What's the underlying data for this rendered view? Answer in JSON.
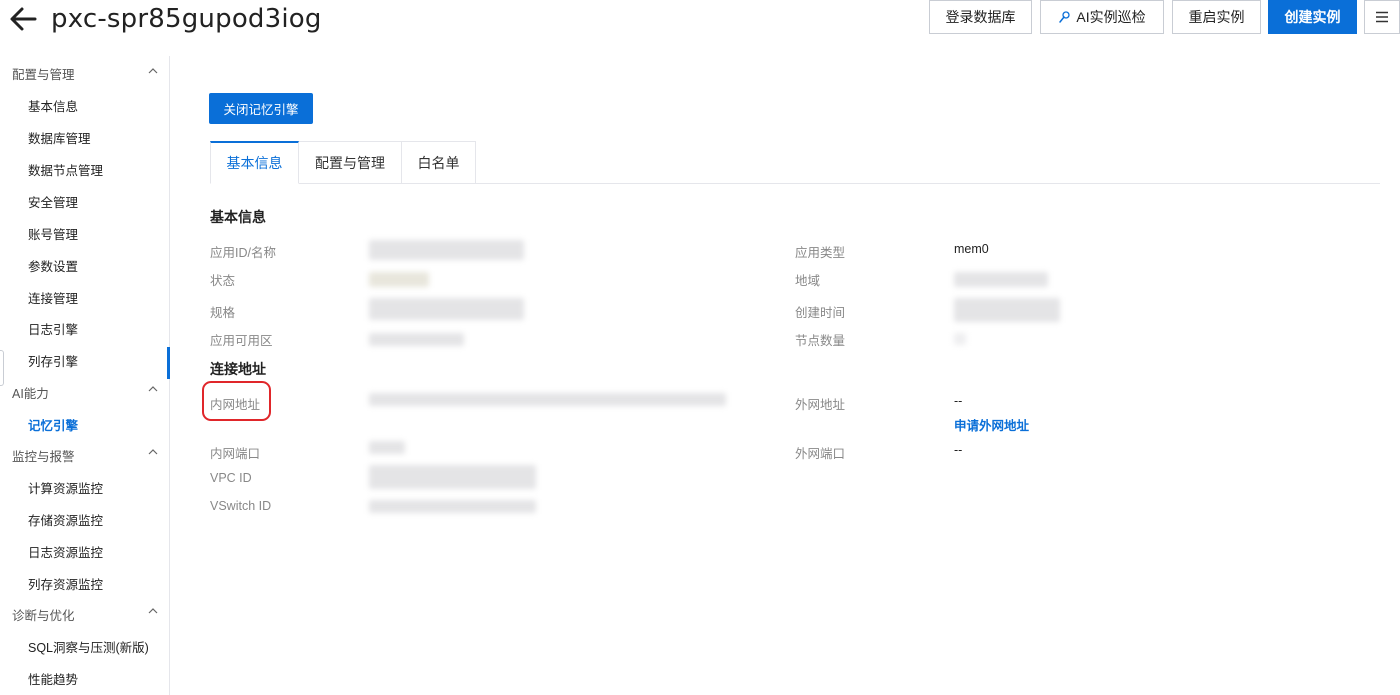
{
  "header": {
    "title": "pxc-spr85gupod3iog",
    "buttons": {
      "login_db": "登录数据库",
      "ai_inspect": "AI实例巡检",
      "restart": "重启实例",
      "create": "创建实例"
    }
  },
  "sidebar": {
    "groups": [
      {
        "label": "配置与管理",
        "items": [
          "基本信息",
          "数据库管理",
          "数据节点管理",
          "安全管理",
          "账号管理",
          "参数设置",
          "连接管理",
          "日志引擎",
          "列存引擎"
        ]
      },
      {
        "label": "AI能力",
        "items": [
          "记忆引擎"
        ]
      },
      {
        "label": "监控与报警",
        "items": [
          "计算资源监控",
          "存储资源监控",
          "日志资源监控",
          "列存资源监控"
        ]
      },
      {
        "label": "诊断与优化",
        "items": [
          "SQL洞察与压测(新版)",
          "性能趋势"
        ]
      }
    ],
    "active_item": "记忆引擎"
  },
  "main": {
    "close_button": "关闭记忆引擎",
    "tabs": [
      "基本信息",
      "配置与管理",
      "白名单"
    ],
    "active_tab": "基本信息",
    "basic_info": {
      "title": "基本信息",
      "app_id_label": "应用ID/名称",
      "status_label": "状态",
      "spec_label": "规格",
      "zone_label": "应用可用区",
      "app_type_label": "应用类型",
      "app_type_value": "mem0",
      "region_label": "地域",
      "created_label": "创建时间",
      "nodes_label": "节点数量"
    },
    "connection": {
      "title": "连接地址",
      "intranet_addr_label": "内网地址",
      "internet_addr_label": "外网地址",
      "internet_addr_value": "--",
      "apply_internet_link": "申请外网地址",
      "intranet_port_label": "内网端口",
      "internet_port_label": "外网端口",
      "internet_port_value": "--",
      "vpc_label": "VPC ID",
      "vswitch_label": "VSwitch ID"
    }
  },
  "colors": {
    "accent": "#0a6fd8",
    "highlight_ring": "#e0262a"
  }
}
